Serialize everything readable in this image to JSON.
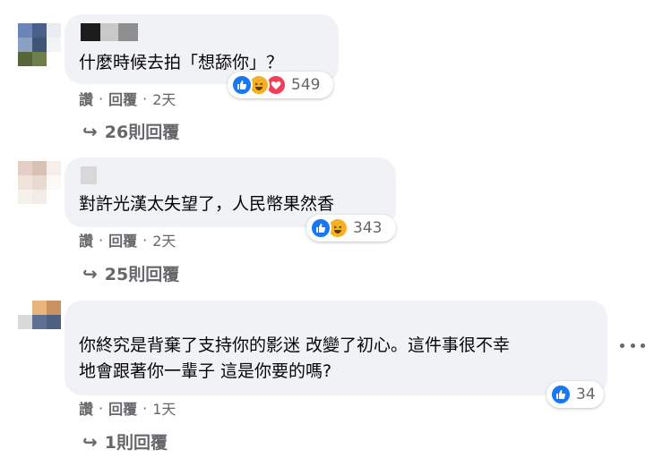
{
  "comments": [
    {
      "text_lines": [
        "什麼時候去拍「想舔你」？"
      ],
      "reactions": {
        "icons": [
          "like-icon",
          "haha-icon",
          "love-icon"
        ],
        "count": "549"
      },
      "actions": {
        "like": "讚",
        "reply": "回覆",
        "time": "2天"
      },
      "replies": "26則回覆"
    },
    {
      "text_lines": [
        "對許光漢太失望了，人民幣果然香"
      ],
      "reactions": {
        "icons": [
          "like-icon",
          "haha-icon"
        ],
        "count": "343"
      },
      "actions": {
        "like": "讚",
        "reply": "回覆",
        "time": "2天"
      },
      "replies": "25則回覆"
    },
    {
      "text_lines": [
        "你終究是背棄了支持你的影迷 改變了初心。這件事很不幸",
        "地會跟著你一輩子 這是你要的嗎?"
      ],
      "reactions": {
        "icons": [
          "like-icon"
        ],
        "count": "34"
      },
      "actions": {
        "like": "讚",
        "reply": "回覆",
        "time": "1天"
      },
      "replies": "1則回覆",
      "more_icon": "more-options-icon"
    }
  ],
  "separator": "·",
  "reply_arrow_icon": "reply-arrow-icon",
  "colors": {
    "bubble": "#f0f2f5",
    "meta_text": "#65676b",
    "like_blue": "#1877f2",
    "haha_yellow": "#f7b125",
    "love_red": "#f33e58"
  }
}
